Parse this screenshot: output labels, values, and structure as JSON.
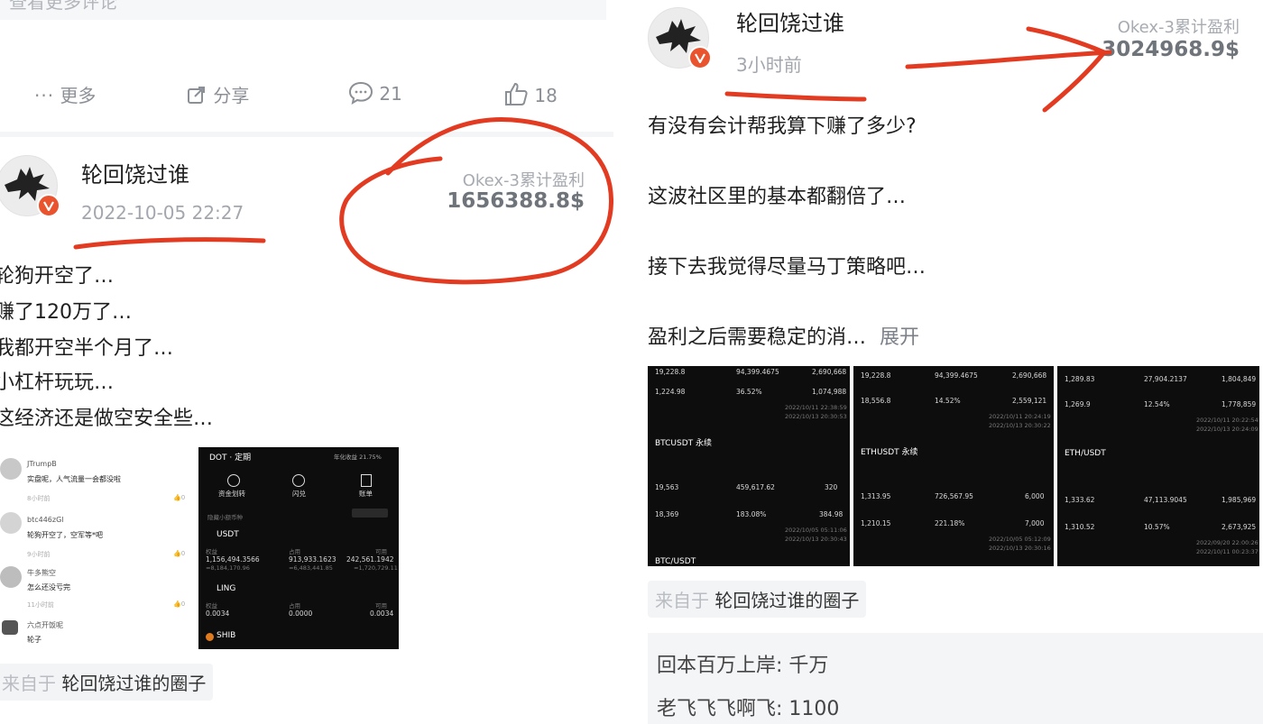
{
  "left": {
    "top_cut_text": "查看更多评论",
    "actions": [
      {
        "icon": "more-icon",
        "label": "更多"
      },
      {
        "icon": "share-icon",
        "label": "分享"
      },
      {
        "icon": "comment-icon",
        "label": "21"
      },
      {
        "icon": "like-icon",
        "label": "18"
      }
    ],
    "post": {
      "username": "轮回饶过谁",
      "time": "2022-10-05 22:27",
      "pl_label": "Okex-3累计盈利",
      "pl_value": "1656388.8$",
      "lines": [
        "轮狗开空了…",
        "赚了120万了…",
        "我都开空半个月了…",
        "小杠杆玩玩…",
        "这经济还是做空安全些…"
      ],
      "source_prefix": "来自于",
      "source_name": "轮回饶过谁的圈子"
    },
    "shot_comments": [
      {
        "user": "JTrumpB",
        "text": "实盘呢，人气流量一会都没啦",
        "time": "8小时前",
        "likes": "0"
      },
      {
        "user": "btc446zGl",
        "text": "轮狗开空了，空军等*吧",
        "time": "9小时前",
        "likes": "0"
      },
      {
        "user": "牛多熊空",
        "text": "怎么还没亏完",
        "time": "11小时前",
        "likes": "0"
      },
      {
        "user": "六点开饭呢",
        "text": "轮子",
        "time": "",
        "likes": ""
      }
    ],
    "shot_wallet": {
      "header": "DOT · 定期",
      "header_right": "年化收益 21.75%",
      "tabs": [
        "资金划转",
        "闪兑",
        "账单"
      ],
      "filter": "隐藏小额币种",
      "assets": [
        {
          "name": "USDT",
          "c1_label": "权益",
          "c1": "1,156,494.3566",
          "c1_sub": "≈8,184,170.96",
          "c2_label": "占用",
          "c2": "913,933.1623",
          "c2_sub": "≈6,483,441.85",
          "c3_label": "可用",
          "c3": "242,561.1942",
          "c3_sub": "≈1,720,729.11"
        },
        {
          "name": "LING",
          "c1_label": "权益",
          "c1": "0.0034",
          "c1_sub": "",
          "c2_label": "占用",
          "c2": "0.0000",
          "c2_sub": "",
          "c3_label": "可用",
          "c3": "0.0034",
          "c3_sub": ""
        },
        {
          "name": "SHIB",
          "c1_label": "",
          "c1": "",
          "c1_sub": "",
          "c2_label": "",
          "c2": "",
          "c2_sub": "",
          "c3_label": "",
          "c3": "",
          "c3_sub": ""
        }
      ]
    }
  },
  "right": {
    "post": {
      "username": "轮回饶过谁",
      "time": "3小时前",
      "pl_label": "Okex-3累计盈利",
      "pl_value": "3024968.9$",
      "lines": [
        "有没有会计帮我算下赚了多少?",
        "这波社区里的基本都翻倍了…",
        "接下去我觉得尽量马丁策略吧…",
        "盈利之后需要稳定的消…"
      ],
      "expand": "展开",
      "source_prefix": "来自于",
      "source_name": "轮回饶过谁的圈子"
    },
    "shots": [
      {
        "top": [
          [
            "19,228.8",
            "94,399.4675",
            "2,690,668"
          ]
        ],
        "r1": [
          "1,224.98",
          "36.52%",
          "1,074,988"
        ],
        "d1": [
          "2022/10/11 22:38:59",
          "2022/10/13 20:30:53"
        ],
        "pair": "BTCUSDT 永续",
        "r2": [
          "19,563",
          "459,617.62",
          "320"
        ],
        "r3": [
          "18,369",
          "183.08%",
          "384.98"
        ],
        "d2": [
          "2022/10/05 05:11:06",
          "2022/10/13 20:30:43"
        ],
        "pair2": "BTC/USDT"
      },
      {
        "r0": [
          "19,228.8",
          "94,399.4675",
          "2,690,668"
        ],
        "r1": [
          "18,556.8",
          "14.52%",
          "2,559,121"
        ],
        "d1": [
          "2022/10/11 20:24:19",
          "2022/10/13 20:30:22"
        ],
        "pair": "ETHUSDT 永续",
        "r2": [
          "1,313.95",
          "726,567.95",
          "6,000"
        ],
        "r3": [
          "1,210.15",
          "221.18%",
          "7,000"
        ],
        "d2": [
          "2022/10/05 05:12:09",
          "2022/10/13 20:30:16"
        ]
      },
      {
        "r0": [
          "1,289.83",
          "27,904.2137",
          "1,804,849"
        ],
        "r1": [
          "1,269.9",
          "12.54%",
          "1,778,859"
        ],
        "d1": [
          "2022/10/11 20:22:54",
          "2022/10/13 20:24:09"
        ],
        "pair": "ETH/USDT",
        "r2": [
          "1,333.62",
          "47,113.9045",
          "1,985,969"
        ],
        "r3": [
          "1,310.52",
          "10.57%",
          "2,673,925"
        ],
        "d2": [
          "2022/09/20 22:00:26",
          "2022/10/11 00:23:37"
        ]
      }
    ],
    "comments": [
      {
        "user": "回本百万上岸",
        "text": "千万"
      },
      {
        "user": "老飞飞飞啊飞",
        "text": "1100"
      }
    ]
  },
  "colors": {
    "annotation_red": "#e23b22",
    "accent": "#e9542f"
  }
}
